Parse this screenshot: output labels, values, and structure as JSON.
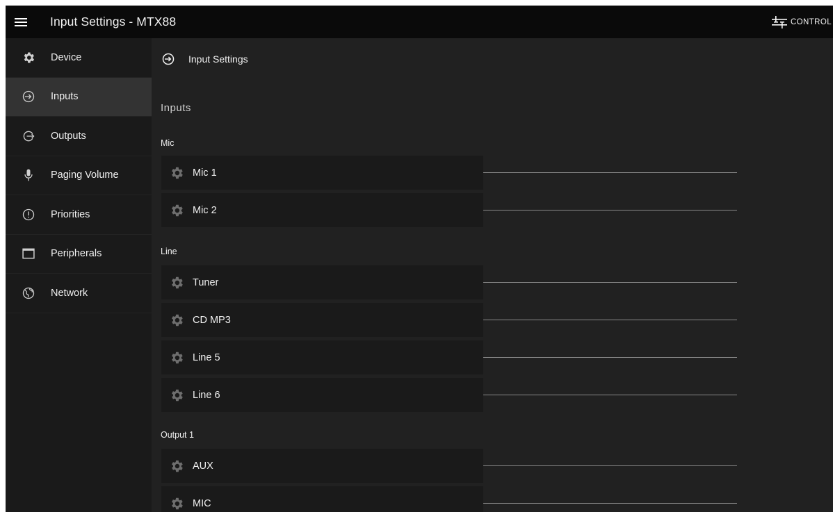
{
  "header": {
    "title": "Input Settings - MTX88",
    "control_label": "CONTROL"
  },
  "sidebar": {
    "items": [
      {
        "label": "Device",
        "icon": "gear-icon"
      },
      {
        "label": "Inputs",
        "icon": "input-icon",
        "active": true
      },
      {
        "label": "Outputs",
        "icon": "output-icon"
      },
      {
        "label": "Paging Volume",
        "icon": "microphone-icon"
      },
      {
        "label": "Priorities",
        "icon": "priority-alert-icon"
      },
      {
        "label": "Peripherals",
        "icon": "window-icon"
      },
      {
        "label": "Network",
        "icon": "globe-icon"
      }
    ]
  },
  "main": {
    "page_title": "Input Settings",
    "section_title": "Inputs",
    "groups": [
      {
        "label": "Mic",
        "inputs": [
          "Mic 1",
          "Mic 2"
        ]
      },
      {
        "label": "Line",
        "inputs": [
          "Tuner",
          "CD MP3",
          "Line 5",
          "Line 6"
        ]
      },
      {
        "label": "Output 1",
        "inputs": [
          "AUX",
          "MIC"
        ]
      }
    ]
  },
  "colors": {
    "topbar": "#0a0a0a",
    "sidebar": "#1a1a1a",
    "sidebar_active": "#333333",
    "main": "#212121",
    "row": "#1a1a1a",
    "slider_line": "#8a8a8a"
  }
}
